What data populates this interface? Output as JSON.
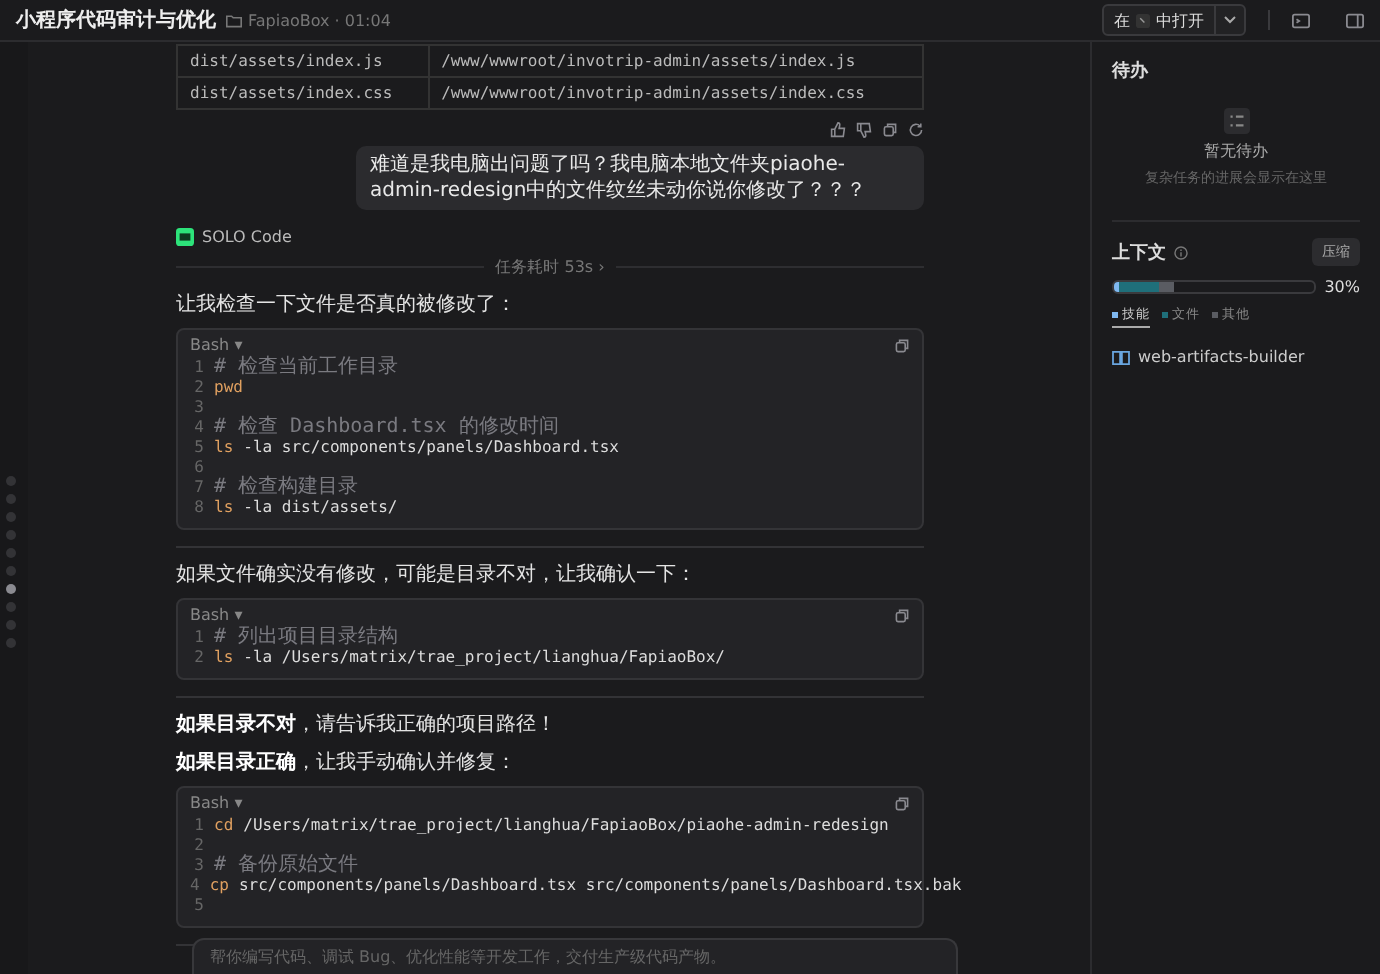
{
  "header": {
    "title": "小程序代码审计与优化",
    "project": "FapiaoBox · 01:04",
    "open_button": {
      "prefix": "在",
      "suffix": "中打开"
    }
  },
  "nav_dots": [
    {
      "selected": false
    },
    {
      "selected": false
    },
    {
      "selected": false
    },
    {
      "selected": false
    },
    {
      "selected": false
    },
    {
      "selected": false
    },
    {
      "selected": true
    },
    {
      "selected": false
    },
    {
      "selected": false
    },
    {
      "selected": false
    }
  ],
  "file_table": {
    "rows": [
      [
        "dist/assets/index.js",
        "/www/wwwroot/invotrip-admin/assets/index.js"
      ],
      [
        "dist/assets/index.css",
        "/www/wwwroot/invotrip-admin/assets/index.css"
      ]
    ]
  },
  "user_message": "难道是我电脑出问题了吗？我电脑本地文件夹piaohe-admin-redesign中的文件纹丝未动你说你修改了？？？",
  "agent": {
    "name": "SOLO Code",
    "duration": "任务耗时 53s ›"
  },
  "blocks": [
    {
      "kind": "text",
      "text": "让我检查一下文件是否真的被修改了："
    },
    {
      "kind": "code",
      "language": "Bash",
      "caret": "▾",
      "lines": [
        {
          "kind": "comment",
          "n": "1",
          "text": "# 检查当前工作目录"
        },
        {
          "kind": "command",
          "n": "2",
          "cmd": "pwd"
        },
        {
          "kind": "blank",
          "n": "3"
        },
        {
          "kind": "comment",
          "n": "4",
          "text": "# 检查 Dashboard.tsx 的修改时间"
        },
        {
          "kind": "command",
          "n": "5",
          "cmd": "ls",
          "args": "-la src/components/panels/Dashboard.tsx"
        },
        {
          "kind": "blank",
          "n": "6"
        },
        {
          "kind": "comment",
          "n": "7",
          "text": "# 检查构建目录"
        },
        {
          "kind": "command",
          "n": "8",
          "cmd": "ls",
          "args": "-la dist/assets/"
        }
      ]
    },
    {
      "kind": "text",
      "text": "如果文件确实没有修改，可能是目录不对，让我确认一下："
    },
    {
      "kind": "code",
      "language": "Bash",
      "caret": "▾",
      "lines": [
        {
          "kind": "comment",
          "n": "1",
          "text": "# 列出项目目录结构"
        },
        {
          "kind": "command",
          "n": "2",
          "cmd": "ls",
          "args": "-la /Users/matrix/trae_project/lianghua/FapiaoBox/"
        }
      ]
    },
    {
      "kind": "text",
      "text": "**如果目录不对**，请告诉我正确的项目路径！"
    },
    {
      "kind": "text",
      "text": "**如果目录正确**，让我手动确认并修复："
    },
    {
      "kind": "code",
      "language": "Bash",
      "caret": "▾",
      "lines": [
        {
          "kind": "command",
          "n": "1",
          "cmd": "cd",
          "args": "/Users/matrix/trae_project/lianghua/FapiaoBox/piaohe-admin-redesign"
        },
        {
          "kind": "blank",
          "n": "2"
        },
        {
          "kind": "comment",
          "n": "3",
          "text": "# 备份原始文件"
        },
        {
          "kind": "command",
          "n": "4",
          "cmd": "cp",
          "args": "src/components/panels/Dashboard.tsx src/components/panels/Dashboard.tsx.bak"
        },
        {
          "kind": "blank",
          "n": "5"
        }
      ]
    }
  ],
  "input": {
    "placeholder": "帮你编写代码、调试 Bug、优化性能等开发工作，交付生产级代码产物。"
  },
  "todo": {
    "title": "待办",
    "empty_title": "暂无待办",
    "empty_hint": "复杂任务的进展会显示在这里"
  },
  "context": {
    "title": "上下文",
    "compress_button": "压缩",
    "percent": "30%",
    "level": 0.3,
    "segments": [
      {
        "label": "技能",
        "color": "#7fb8f0",
        "selected": true
      },
      {
        "label": "文件",
        "color": "#1f6f7a",
        "selected": false
      },
      {
        "label": "其他",
        "color": "#5a5c62",
        "selected": false
      }
    ],
    "skills": [
      {
        "name": "web-artifacts-builder"
      }
    ]
  }
}
